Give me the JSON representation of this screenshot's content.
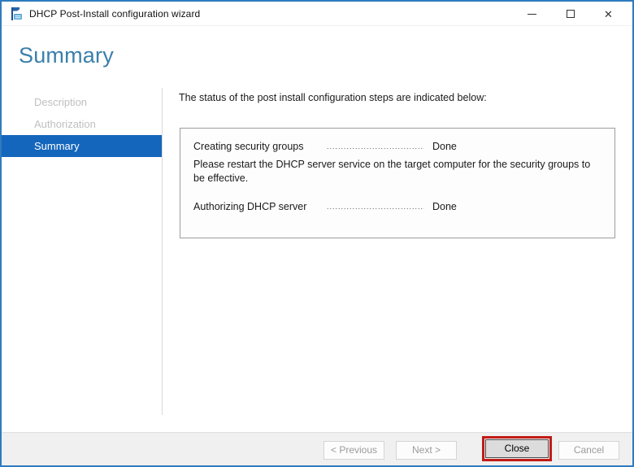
{
  "window": {
    "title": "DHCP Post-Install configuration wizard",
    "icon": "dhcp-server-icon",
    "border_color": "#2e7bbf",
    "controls": [
      {
        "name": "minimize"
      },
      {
        "name": "maximize"
      },
      {
        "name": "close"
      }
    ]
  },
  "page": {
    "heading": "Summary",
    "heading_color": "#3a7fab"
  },
  "sidebar": {
    "selected_bg": "#1466bc",
    "items": [
      {
        "label": "Description",
        "state": "disabled"
      },
      {
        "label": "Authorization",
        "state": "disabled"
      },
      {
        "label": "Summary",
        "state": "selected"
      }
    ]
  },
  "content": {
    "intro": "The status of the post install configuration steps are indicated below:",
    "steps": [
      {
        "label": "Creating security groups",
        "leader": "..............................................",
        "status": "Done",
        "note": "Please restart the DHCP server service on the target computer for the security groups to be effective."
      },
      {
        "label": "Authorizing DHCP server",
        "leader": "..............................................",
        "status": "Done"
      }
    ]
  },
  "footer": {
    "highlight_color": "#c11b17",
    "buttons": [
      {
        "label": "< Previous",
        "state": "disabled"
      },
      {
        "label": "Next >",
        "state": "disabled"
      },
      {
        "label": "Close",
        "state": "enabled",
        "highlighted": true
      },
      {
        "label": "Cancel",
        "state": "disabled"
      }
    ]
  }
}
